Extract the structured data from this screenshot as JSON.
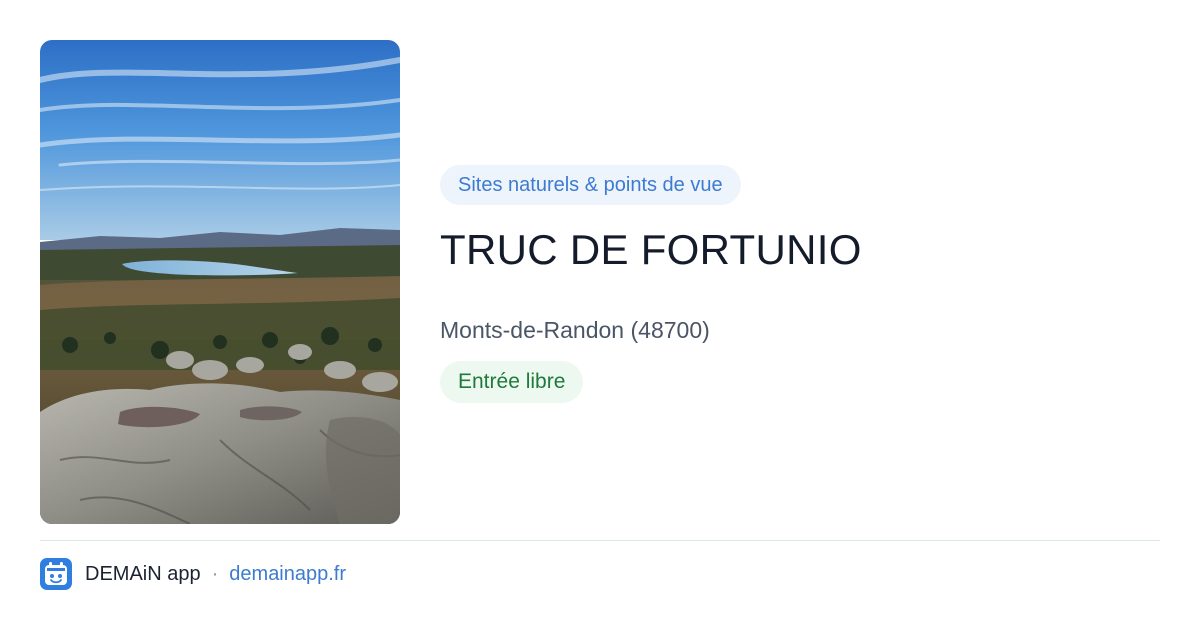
{
  "preview": {
    "image": {
      "alt": "TRUC DE FORTUNIO"
    },
    "category": "Sites naturels & points de vue",
    "title": "TRUC DE FORTUNIO",
    "location": "Monts-de-Randon (48700)",
    "entry": "Entrée libre"
  },
  "footer": {
    "logo_icon": "demain-app-logo-icon",
    "brand": "DEMAiN app",
    "separator": "·",
    "domain": "demainapp.fr"
  },
  "colors": {
    "category_bg": "#eef4fc",
    "category_text": "#3c7bd0",
    "entry_bg": "#edf8f0",
    "entry_text": "#1f7a3b",
    "title_text": "#141b2b",
    "logo_blue": "#2f7fe0"
  }
}
